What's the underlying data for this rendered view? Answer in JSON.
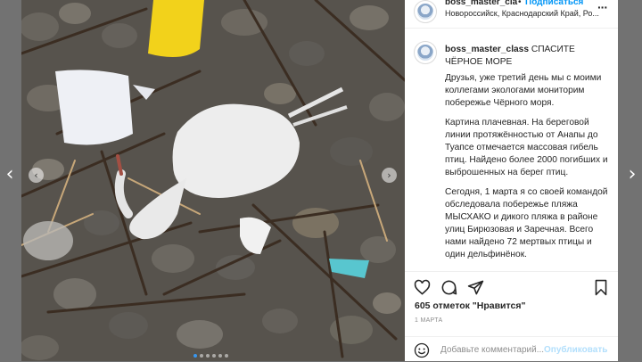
{
  "post": {
    "username": "boss_master_class",
    "header_username": "boss_master_cla",
    "follow_label": "Подписаться",
    "dot": "•",
    "location": "Новороссийск, Краснодарский Край, Ро...",
    "caption_title": "СПАСИТЕ ЧЁРНОЕ МОРЕ",
    "paragraphs": [
      "Друзья, уже третий день мы с моими коллегами экологами мониторим побережье Чёрного моря.",
      "Картина плачевная. На береговой линии протяжённостью от Анапы до Туапсе отмечается массовая гибель птиц. Найдено более 2000 погибших и выброшенных на берег птиц.",
      "Сегодня, 1 марта я со своей командой обследовала побережье пляжа МЫСХАКО и дикого пляжа в районе улиц Бирюзовая и Заречная. Всего нами найдено 72 мертвых птицы и один дельфинёнок."
    ],
    "likes": "605 отметок \"Нравится\"",
    "date": "1 МАРТА",
    "comment_placeholder": "Добавьте комментарий...",
    "publish_label": "Опубликовать"
  },
  "photo": {
    "description_icons": [
      "dead-bird",
      "plastic-bag",
      "yellow-container",
      "stones",
      "twigs"
    ],
    "carousel_dots": 6,
    "active_dot": 0
  },
  "icons": {
    "left": "chevron-left-icon",
    "right": "chevron-right-icon",
    "like": "heart-icon",
    "comment": "comment-icon",
    "share": "share-icon",
    "save": "bookmark-icon",
    "emoji": "emoji-icon",
    "more": "more-icon"
  },
  "colors": {
    "link": "#0095f6",
    "publish_disabled": "#b2dffc",
    "carousel_active": "#3897f0"
  }
}
